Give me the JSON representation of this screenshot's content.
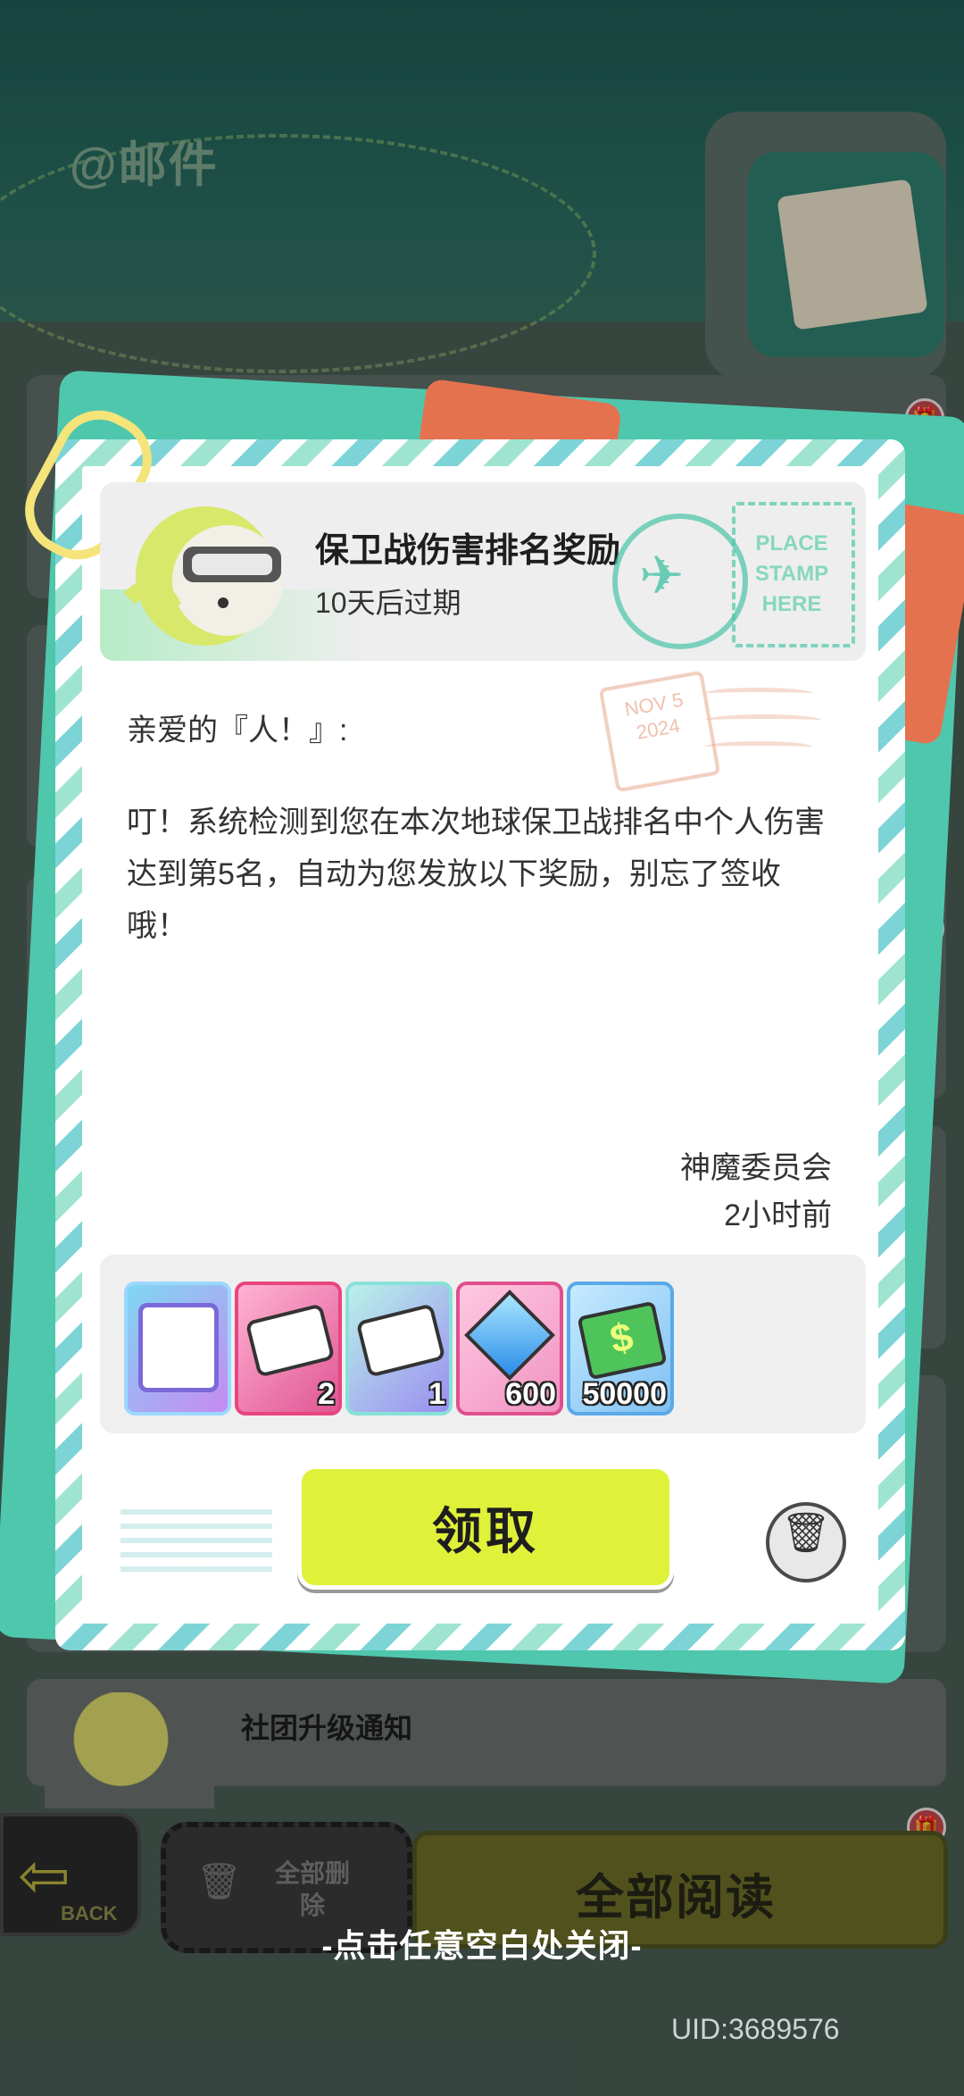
{
  "page": {
    "mail_section_title": "@邮件",
    "close_hint": "-点击任意空白处关闭-",
    "uid": "UID:3689576"
  },
  "mail": {
    "subject": "保卫战伤害排名奖励",
    "expire": "10天后过期",
    "greeting": "亲爱的『人！』:",
    "body": "叮！系统检测到您在本次地球保卫战排名中个人伤害达到第5名，自动为您发放以下奖励，别忘了签收哦！",
    "sender": "神魔委员会",
    "sent_time": "2小时前",
    "stamp_text": "PLACE STAMP HERE",
    "postmark_text": "NOV 5 2024"
  },
  "rewards": [
    {
      "name": "avatar-frame",
      "count": ""
    },
    {
      "name": "ticket-pink",
      "count": "2"
    },
    {
      "name": "ticket-purple",
      "count": "1"
    },
    {
      "name": "diamond",
      "count": "600"
    },
    {
      "name": "cash",
      "count": "50000"
    }
  ],
  "buttons": {
    "claim": "领取",
    "back": "BACK",
    "delete_all": "全部删除",
    "read_all": "全部阅读"
  },
  "list": {
    "club_notice_title": "社团升级通知"
  },
  "colors": {
    "accent_yellow": "#e0f13a",
    "teal": "#4fc7ad",
    "orange": "#e4724f"
  }
}
